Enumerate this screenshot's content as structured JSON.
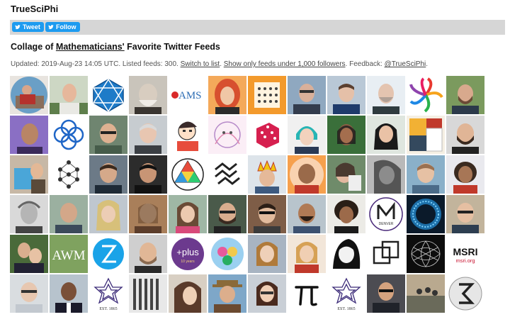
{
  "site": {
    "brand": "TrueSciPhi"
  },
  "share": {
    "tweet_label": "Tweet",
    "follow_label": "Follow"
  },
  "page": {
    "title_before": "Collage of ",
    "title_link": "Mathematicians'",
    "title_after": " Favorite Twitter Feeds"
  },
  "meta": {
    "prefix": "Updated: 2019-Aug-23 14:05 UTC. Listed feeds: 300. ",
    "switch_link": "Switch to list",
    "sep1": ". ",
    "filter_link": "Show only feeds under 1,000 followers",
    "sep2": ". Feedback: ",
    "feedback_link": "@TrueSciPhi",
    "end": "."
  },
  "tile_text": {
    "ams": "AMS",
    "awm": "AWM",
    "plus": "+plus",
    "plus_sub": "10 years",
    "denver": "DENVER",
    "msri_name": "MSRI",
    "msri_url": "msri.org",
    "est": "EST. 1865"
  },
  "colors": {
    "tweet_blue": "#1d9bf0",
    "share_bar": "#d6d6d6",
    "ams_blue": "#2e6db4",
    "awm_green": "#7fa25f",
    "msri_red": "#c8102e",
    "plus_purple": "#6c3a8e"
  }
}
